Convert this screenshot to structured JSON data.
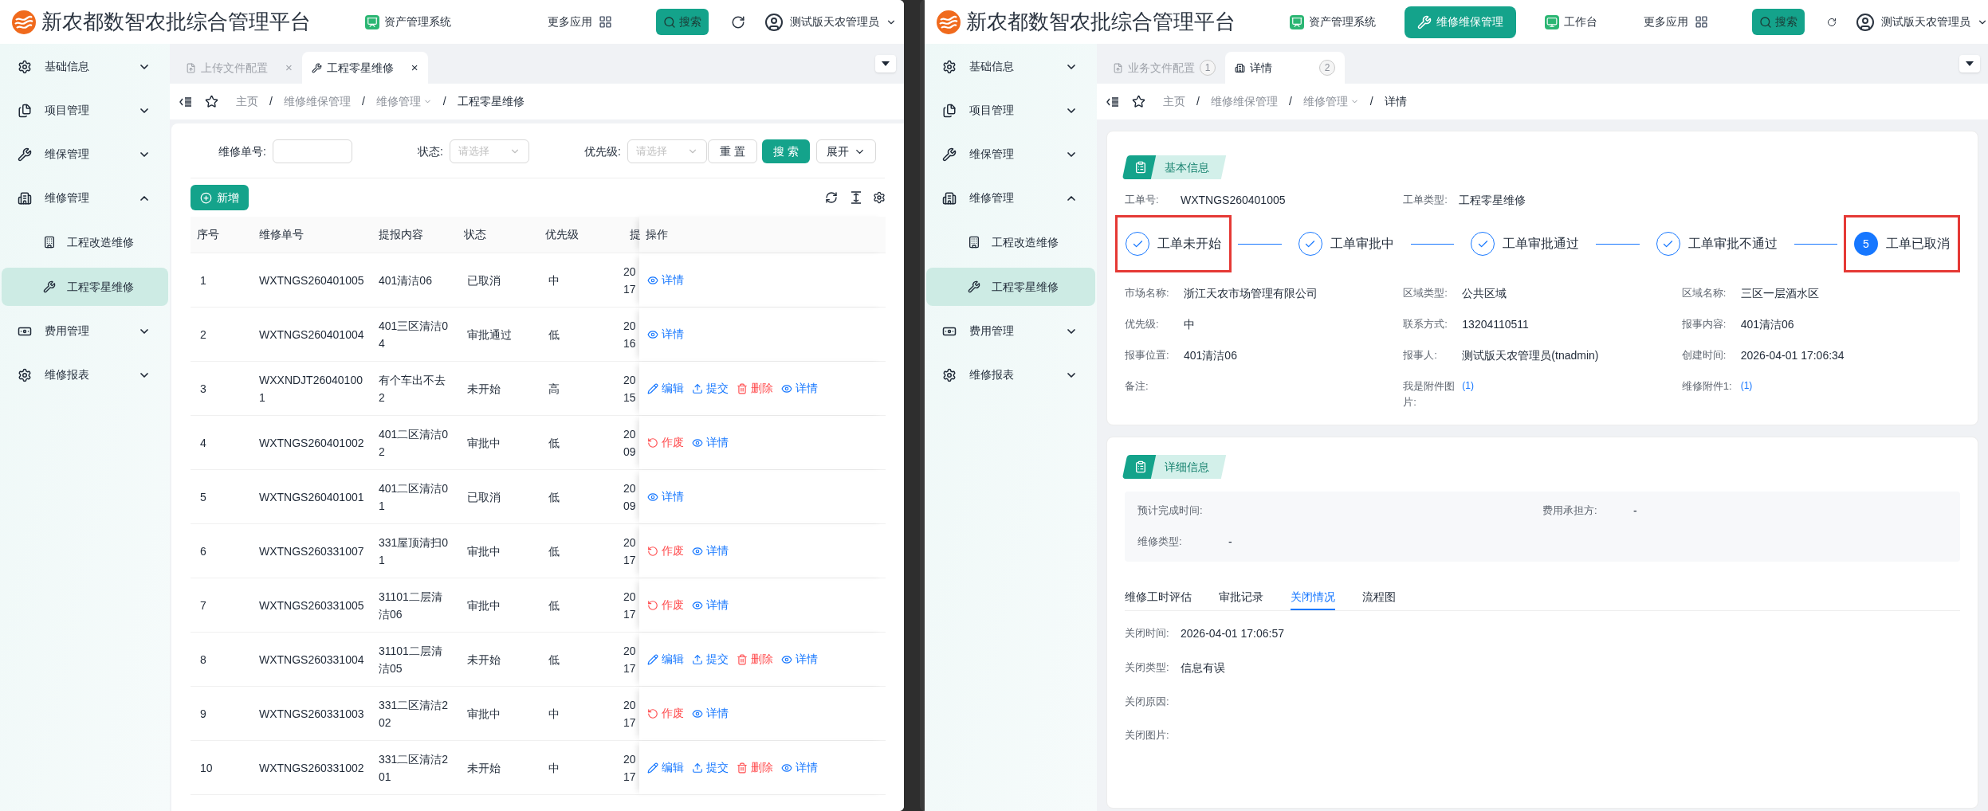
{
  "left_window": {
    "header": {
      "title": "新农都数智农批综合管理平台",
      "nav": [
        {
          "label": "资产管理系统",
          "selected": false
        }
      ],
      "more_apps": "更多应用",
      "search_button": "搜索",
      "user": "测试版天农管理员"
    },
    "sidebar": {
      "items": [
        {
          "label": "基础信息",
          "expanded": false
        },
        {
          "label": "项目管理",
          "expanded": false
        },
        {
          "label": "维保管理",
          "expanded": false
        },
        {
          "label": "维修管理",
          "expanded": true,
          "children": [
            {
              "label": "工程改造维修",
              "selected": false
            },
            {
              "label": "工程零星维修",
              "selected": true
            }
          ]
        },
        {
          "label": "费用管理",
          "expanded": false
        },
        {
          "label": "维修报表",
          "expanded": false
        }
      ]
    },
    "tabs": [
      {
        "label": "上传文件配置",
        "close": "×",
        "selected": false
      },
      {
        "label": "工程零星维修",
        "close": "×",
        "selected": true
      }
    ],
    "breadcrumb": {
      "separator": "/",
      "items": [
        {
          "label": "主页",
          "dropdown": false
        },
        {
          "label": "维修维保管理",
          "dropdown": false
        },
        {
          "label": "维修管理",
          "dropdown": true
        },
        {
          "label": "工程零星维修",
          "dropdown": false
        }
      ]
    },
    "filters": [
      {
        "kind": "input",
        "label": "维修单号:"
      },
      {
        "kind": "select",
        "label": "状态:",
        "placeholder": "请选择"
      },
      {
        "kind": "select",
        "label": "优先级:",
        "placeholder": "请选择"
      }
    ],
    "buttons": {
      "reset": "重 置",
      "search": "搜 索",
      "expand": "展开"
    },
    "new_button": "新增",
    "table": {
      "columns": [
        "序号",
        "维修单号",
        "提报内容",
        "状态",
        "优先级",
        "提",
        "操作"
      ],
      "rows": [
        {
          "no": "1",
          "code": "WXTNGS260401005",
          "content": "401清洁06",
          "status": "已取消",
          "priority": "中",
          "column_6": [
            "20",
            "17"
          ],
          "actions": [
            {
              "kind": "detail",
              "label": "详情"
            }
          ]
        },
        {
          "no": "2",
          "code": "WXTNGS260401004",
          "content": "401三区清洁04",
          "status": "审批通过",
          "priority": "低",
          "column_6": [
            "20",
            "16"
          ],
          "actions": [
            {
              "kind": "detail",
              "label": "详情"
            }
          ]
        },
        {
          "no": "3",
          "code": "WXXNDJT260401001",
          "content": "有个车出不去2",
          "status": "未开始",
          "priority": "高",
          "column_6": [
            "20",
            "15"
          ],
          "actions": [
            {
              "kind": "edit",
              "label": "编辑"
            },
            {
              "kind": "submit",
              "label": "提交"
            },
            {
              "kind": "delete",
              "label": "删除"
            },
            {
              "kind": "detail",
              "label": "详情"
            }
          ]
        },
        {
          "no": "4",
          "code": "WXTNGS260401002",
          "content": "401二区清洁02",
          "status": "审批中",
          "priority": "低",
          "column_6": [
            "20",
            "09"
          ],
          "actions": [
            {
              "kind": "void",
              "label": "作废"
            },
            {
              "kind": "detail",
              "label": "详情"
            }
          ]
        },
        {
          "no": "5",
          "code": "WXTNGS260401001",
          "content": "401二区清洁01",
          "status": "已取消",
          "priority": "低",
          "column_6": [
            "20",
            "09"
          ],
          "actions": [
            {
              "kind": "detail",
              "label": "详情"
            }
          ]
        },
        {
          "no": "6",
          "code": "WXTNGS260331007",
          "content": "331屋顶清扫01",
          "status": "审批中",
          "priority": "低",
          "column_6": [
            "20",
            "17"
          ],
          "actions": [
            {
              "kind": "void",
              "label": "作废"
            },
            {
              "kind": "detail",
              "label": "详情"
            }
          ]
        },
        {
          "no": "7",
          "code": "WXTNGS260331005",
          "content": "31101二层清洁06",
          "status": "审批中",
          "priority": "低",
          "column_6": [
            "20",
            "17"
          ],
          "actions": [
            {
              "kind": "void",
              "label": "作废"
            },
            {
              "kind": "detail",
              "label": "详情"
            }
          ]
        },
        {
          "no": "8",
          "code": "WXTNGS260331004",
          "content": "31101二层清洁05",
          "status": "未开始",
          "priority": "低",
          "column_6": [
            "20",
            "17"
          ],
          "actions": [
            {
              "kind": "edit",
              "label": "编辑"
            },
            {
              "kind": "submit",
              "label": "提交"
            },
            {
              "kind": "delete",
              "label": "删除"
            },
            {
              "kind": "detail",
              "label": "详情"
            }
          ]
        },
        {
          "no": "9",
          "code": "WXTNGS260331003",
          "content": "331二区清洁202",
          "status": "审批中",
          "priority": "中",
          "column_6": [
            "20",
            "17"
          ],
          "actions": [
            {
              "kind": "void",
              "label": "作废"
            },
            {
              "kind": "detail",
              "label": "详情"
            }
          ]
        },
        {
          "no": "10",
          "code": "WXTNGS260331002",
          "content": "331二区清洁201",
          "status": "未开始",
          "priority": "中",
          "column_6": [
            "20",
            "17"
          ],
          "actions": [
            {
              "kind": "edit",
              "label": "编辑"
            },
            {
              "kind": "submit",
              "label": "提交"
            },
            {
              "kind": "delete",
              "label": "删除"
            },
            {
              "kind": "detail",
              "label": "详情"
            }
          ]
        }
      ]
    }
  },
  "right_window": {
    "header": {
      "title": "新农都数智农批综合管理平台",
      "nav": [
        {
          "label": "资产管理系统",
          "selected": false
        },
        {
          "label": "维修维保管理",
          "selected": true
        },
        {
          "label": "工作台",
          "selected": false
        }
      ],
      "more_apps": "更多应用",
      "search_button": "搜索",
      "user": "测试版天农管理员"
    },
    "sidebar": {
      "items": [
        {
          "label": "基础信息",
          "expanded": false
        },
        {
          "label": "项目管理",
          "expanded": false
        },
        {
          "label": "维保管理",
          "expanded": false
        },
        {
          "label": "维修管理",
          "expanded": true,
          "children": [
            {
              "label": "工程改造维修",
              "selected": false
            },
            {
              "label": "工程零星维修",
              "selected": true
            }
          ]
        },
        {
          "label": "费用管理",
          "expanded": false
        },
        {
          "label": "维修报表",
          "expanded": false
        }
      ]
    },
    "tabs": [
      {
        "label": "业务文件配置",
        "badge": "1",
        "selected": false
      },
      {
        "label": "详情",
        "badge": "2",
        "selected": true
      }
    ],
    "breadcrumb": {
      "separator": "/",
      "items": [
        {
          "label": "主页",
          "dropdown": false
        },
        {
          "label": "维修维保管理",
          "dropdown": false
        },
        {
          "label": "维修管理",
          "dropdown": true
        },
        {
          "label": "详情",
          "dropdown": false
        }
      ]
    },
    "basic_info": {
      "title": "基本信息",
      "top_fields": [
        {
          "label": "工单号:",
          "value": "WXTNGS260401005"
        },
        {
          "label": "工单类型:",
          "value": "工程零星维修"
        }
      ],
      "steps": [
        {
          "label": "工单未开始",
          "completed": true,
          "highlighted": true
        },
        {
          "label": "工单审批中",
          "completed": true,
          "highlighted": false
        },
        {
          "label": "工单审批通过",
          "completed": true,
          "highlighted": false
        },
        {
          "label": "工单审批不通过",
          "completed": true,
          "highlighted": false
        },
        {
          "label": "工单已取消",
          "completed": false,
          "number": "5",
          "highlighted": true
        }
      ],
      "fields": [
        {
          "label": "市场名称:",
          "value": "浙江天农市场管理有限公司"
        },
        {
          "label": "区域类型:",
          "value": "公共区域"
        },
        {
          "label": "区域名称:",
          "value": "三区一层酒水区"
        },
        {
          "label": "优先级:",
          "value": "中"
        },
        {
          "label": "联系方式:",
          "value": "13204110511"
        },
        {
          "label": "报事内容:",
          "value": "401清洁06"
        },
        {
          "label": "报事位置:",
          "value": "401清洁06"
        },
        {
          "label": "报事人:",
          "value": "测试版天农管理员(tnadmin)"
        },
        {
          "label": "创建时间:",
          "value": "2026-04-01 17:06:34"
        },
        {
          "label": "备注:"
        },
        {
          "label": "我是附件图片:",
          "link": "(1)"
        },
        {
          "label": "维修附件1:",
          "link": "(1)"
        }
      ]
    },
    "detail_info": {
      "title": "详细信息",
      "summary": [
        {
          "label": "预计完成时间:"
        },
        {
          "label": "费用承担方:",
          "value": "-"
        },
        {
          "label": "维修类型:",
          "value": "-"
        }
      ],
      "tabs": [
        {
          "label": "维修工时评估",
          "selected": false
        },
        {
          "label": "审批记录",
          "selected": false
        },
        {
          "label": "关闭情况",
          "selected": true
        },
        {
          "label": "流程图",
          "selected": false
        }
      ],
      "close_fields": [
        {
          "label": "关闭时间:",
          "value": "2026-04-01 17:06:57"
        },
        {
          "label": "关闭类型:",
          "value": "信息有误"
        },
        {
          "label": "关闭原因:"
        },
        {
          "label": "关闭图片:"
        }
      ]
    }
  }
}
